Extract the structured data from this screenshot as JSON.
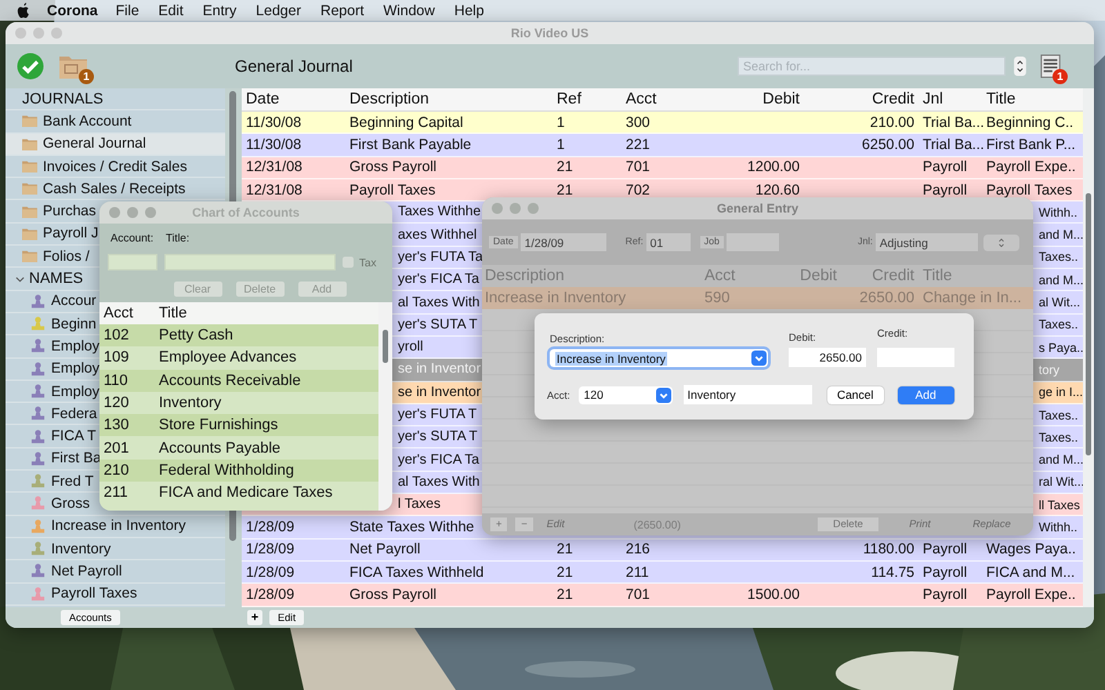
{
  "menu_bar": {
    "app": "Corona",
    "items": [
      "File",
      "Edit",
      "Entry",
      "Ledger",
      "Report",
      "Window",
      "Help"
    ]
  },
  "main_window": {
    "title": "Rio Video US",
    "toolbar": {
      "view_title": "General Journal",
      "folder_badge": "1",
      "search": {
        "placeholder": "Search for..."
      },
      "report_badge": "1"
    },
    "sidebar": {
      "sections": [
        {
          "label": "JOURNALS",
          "kind": "journals",
          "items": [
            {
              "label": "Bank Account",
              "selected": false
            },
            {
              "label": "General Journal",
              "selected": true
            },
            {
              "label": "Invoices / Credit Sales",
              "selected": false
            },
            {
              "label": "Cash Sales / Receipts",
              "selected": false
            },
            {
              "label": "Purchas",
              "selected": false
            },
            {
              "label": "Payroll J",
              "selected": false
            },
            {
              "label": "Folios /",
              "selected": false
            }
          ]
        },
        {
          "label": "NAMES",
          "kind": "names",
          "expanded": true,
          "items": [
            {
              "label": "Accour",
              "color": "#8a7fb8"
            },
            {
              "label": "Beginn",
              "color": "#d8c84a"
            },
            {
              "label": "Employ",
              "color": "#8a7fb8"
            },
            {
              "label": "Employ",
              "color": "#8a7fb8"
            },
            {
              "label": "Employ",
              "color": "#8a7fb8"
            },
            {
              "label": "Federa",
              "color": "#8a7fb8"
            },
            {
              "label": "FICA T",
              "color": "#8a7fb8"
            },
            {
              "label": "First Ba",
              "color": "#8a7fb8"
            },
            {
              "label": "Fred T",
              "color": "#a8ae78"
            },
            {
              "label": "Gross",
              "color": "#e89aaa"
            },
            {
              "label": "Increase in Inventory",
              "color": "#e8a860"
            },
            {
              "label": "Inventory",
              "color": "#a8ae78"
            },
            {
              "label": "Net Payroll",
              "color": "#8a7fb8"
            },
            {
              "label": "Payroll Taxes",
              "color": "#e89aaa"
            }
          ]
        }
      ]
    },
    "table": {
      "columns": [
        {
          "label": "Date",
          "kind": "text"
        },
        {
          "label": "Description",
          "kind": "text"
        },
        {
          "label": "Ref",
          "kind": "text"
        },
        {
          "label": "Acct",
          "kind": "text"
        },
        {
          "label": "Debit",
          "kind": "amount"
        },
        {
          "label": "Credit",
          "kind": "amount"
        },
        {
          "label": "Jnl",
          "kind": "text"
        },
        {
          "label": "Title",
          "kind": "text"
        }
      ],
      "rows": [
        {
          "kind": "full",
          "selected": false,
          "color": "#ffffcc",
          "date": "11/30/08",
          "description": "Beginning Capital",
          "ref": "1",
          "acct": "300",
          "credit": "210.00",
          "jnl": "Trial Ba...",
          "title": "Beginning C.."
        },
        {
          "kind": "full",
          "selected": false,
          "color": "#d8d8ff",
          "date": "11/30/08",
          "description": "First Bank Payable",
          "ref": "1",
          "acct": "221",
          "credit": "6250.00",
          "jnl": "Trial Ba...",
          "title": "First Bank P..."
        },
        {
          "kind": "full",
          "selected": false,
          "color": "#ffd6d6",
          "date": "12/31/08",
          "description": "Gross Payroll",
          "ref": "21",
          "acct": "701",
          "debit": "1200.00",
          "jnl": "Payroll",
          "title": "Payroll Expe.."
        },
        {
          "kind": "full",
          "selected": false,
          "color": "#ffd6d6",
          "date": "12/31/08",
          "description": "Payroll Taxes",
          "ref": "21",
          "acct": "702",
          "debit": "120.60",
          "jnl": "Payroll",
          "title": "Payroll Taxes"
        },
        {
          "kind": "covered",
          "selected": false,
          "color": "#d8d8ff",
          "description": "Taxes Withhe",
          "title": "Withh.."
        },
        {
          "kind": "covered",
          "selected": false,
          "color": "#d8d8ff",
          "description": "axes Withhel",
          "title": "and M..."
        },
        {
          "kind": "covered",
          "selected": false,
          "color": "#d8d8ff",
          "description": "yer's FUTA Ta",
          "title": "Taxes.."
        },
        {
          "kind": "covered",
          "selected": false,
          "color": "#d8d8ff",
          "description": "yer's FICA Ta",
          "title": "and M..."
        },
        {
          "kind": "covered",
          "selected": false,
          "color": "#d8d8ff",
          "description": "al Taxes With",
          "title": "al Wit..."
        },
        {
          "kind": "covered",
          "selected": false,
          "color": "#d8d8ff",
          "description": "yer's SUTA T",
          "title": "Taxes.."
        },
        {
          "kind": "covered",
          "selected": false,
          "color": "#d8d8ff",
          "description": "yroll",
          "title": "s Paya.."
        },
        {
          "kind": "covered",
          "selected": true,
          "description": "se in Inventor",
          "title": "tory"
        },
        {
          "kind": "covered",
          "selected": false,
          "color": "#ffd9b0",
          "description": "se in Inventor",
          "title": "ge in I..."
        },
        {
          "kind": "covered",
          "selected": false,
          "color": "#d8d8ff",
          "description": "yer's FUTA T",
          "title": "Taxes.."
        },
        {
          "kind": "covered",
          "selected": false,
          "color": "#d8d8ff",
          "description": "yer's SUTA T",
          "title": "Taxes.."
        },
        {
          "kind": "covered",
          "selected": false,
          "color": "#d8d8ff",
          "description": "yer's FICA Ta",
          "title": "and M..."
        },
        {
          "kind": "covered",
          "selected": false,
          "color": "#d8d8ff",
          "description": "al Taxes With",
          "title": "ral Wit..."
        },
        {
          "kind": "covered",
          "selected": false,
          "color": "#ffd6d6",
          "description": "l Taxes",
          "title": "ll Taxes"
        },
        {
          "kind": "partly_covered",
          "selected": false,
          "color": "#d8d8ff",
          "date": "1/28/09",
          "description": "State Taxes Withhe",
          "title": "Withh.."
        },
        {
          "kind": "full",
          "selected": false,
          "color": "#d8d8ff",
          "date": "1/28/09",
          "description": "Net Payroll",
          "ref": "21",
          "acct": "216",
          "credit": "1180.00",
          "jnl": "Payroll",
          "title": "Wages Paya.."
        },
        {
          "kind": "full",
          "selected": false,
          "color": "#d8d8ff",
          "date": "1/28/09",
          "description": "FICA Taxes Withheld",
          "ref": "21",
          "acct": "211",
          "credit": "114.75",
          "jnl": "Payroll",
          "title": "FICA and M..."
        },
        {
          "kind": "full",
          "selected": false,
          "color": "#ffd6d6",
          "date": "1/28/09",
          "description": "Gross Payroll",
          "ref": "21",
          "acct": "701",
          "debit": "1500.00",
          "jnl": "Payroll",
          "title": "Payroll Expe.."
        }
      ]
    },
    "bottom_bar": {
      "sidebar_button": "Accounts",
      "add_button": "+",
      "edit_button": "Edit"
    }
  },
  "chart_of_accounts": {
    "title": "Chart of Accounts",
    "account_label": "Account:",
    "title_label": "Title:",
    "tax_checkbox": {
      "label": "Tax",
      "checked": false
    },
    "buttons": [
      "Clear",
      "Delete",
      "Add"
    ],
    "columns": [
      "Acct",
      "Title"
    ],
    "rows": [
      {
        "acct": "102",
        "title": "Petty Cash"
      },
      {
        "acct": "109",
        "title": "Employee Advances"
      },
      {
        "acct": "110",
        "title": "Accounts Receivable"
      },
      {
        "acct": "120",
        "title": "Inventory"
      },
      {
        "acct": "130",
        "title": "Store Furnishings"
      },
      {
        "acct": "201",
        "title": "Accounts Payable"
      },
      {
        "acct": "210",
        "title": "Federal Withholding"
      },
      {
        "acct": "211",
        "title": "FICA and Medicare Taxes"
      }
    ]
  },
  "general_entry": {
    "title": "General Entry",
    "date": {
      "label": "Date",
      "value": "1/28/09"
    },
    "ref": {
      "label": "Ref:",
      "value": "01"
    },
    "job": {
      "label": "Job"
    },
    "journal": {
      "label": "Jnl:",
      "value": "Adjusting"
    },
    "columns": [
      "Description",
      "Acct",
      "Debit",
      "Credit",
      "Title"
    ],
    "rows": [
      {
        "description": "Increase in Inventory",
        "acct": "590",
        "credit": "2650.00",
        "title": "Change in In..."
      }
    ],
    "footer": {
      "left_buttons": [
        {
          "label": "+",
          "disabled": false
        },
        {
          "label": "−",
          "disabled": false
        },
        {
          "label": "Edit",
          "disabled": true
        }
      ],
      "total": "(2650.00)",
      "right_buttons": [
        {
          "label": "Delete",
          "disabled": false
        },
        {
          "label": "Print",
          "disabled": true
        },
        {
          "label": "Replace",
          "disabled": true
        }
      ]
    }
  },
  "entry_dialog": {
    "description": {
      "label": "Description:",
      "value": "Increase in Inventory"
    },
    "debit": {
      "label": "Debit:",
      "value": "2650.00"
    },
    "credit": {
      "label": "Credit:"
    },
    "acct": {
      "label": "Acct:",
      "value": "120"
    },
    "acct_title": {
      "value": "Inventory"
    },
    "buttons": [
      {
        "label": "Cancel",
        "default": false
      },
      {
        "label": "Add",
        "default": true
      }
    ]
  }
}
